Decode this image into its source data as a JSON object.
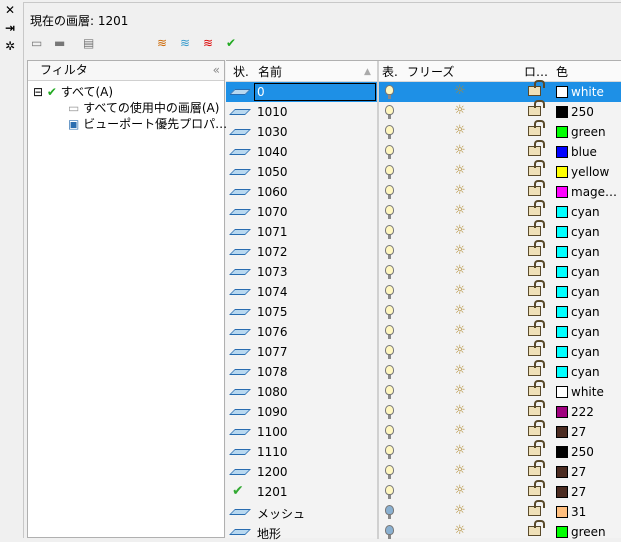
{
  "sidebar_strip": {
    "icons": [
      "close-icon",
      "pin-icon",
      "settings-icon"
    ]
  },
  "title": "現在の画層: 1201",
  "filter": {
    "header": "フィルタ",
    "collapse": "«",
    "tree": [
      {
        "label": "すべて(A)",
        "expanded": true
      },
      {
        "label": "すべての使用中の画層(A)"
      },
      {
        "label": "ビューポート優先プロパ…"
      }
    ]
  },
  "columns": {
    "status": "状.",
    "name": "名前",
    "on": "表.",
    "freeze": "フリーズ",
    "lock": "ロ…",
    "color": "色"
  },
  "layers": [
    {
      "name": "0",
      "color": "white",
      "hex": "#ffffff",
      "on": true,
      "selected": true
    },
    {
      "name": "1010",
      "color": "250",
      "hex": "#000000",
      "on": true
    },
    {
      "name": "1030",
      "color": "green",
      "hex": "#00ff00",
      "on": true
    },
    {
      "name": "1040",
      "color": "blue",
      "hex": "#0000ff",
      "on": true
    },
    {
      "name": "1050",
      "color": "yellow",
      "hex": "#ffff00",
      "on": true
    },
    {
      "name": "1060",
      "color": "mage…",
      "hex": "#ff00ff",
      "on": true
    },
    {
      "name": "1070",
      "color": "cyan",
      "hex": "#00ffff",
      "on": true
    },
    {
      "name": "1071",
      "color": "cyan",
      "hex": "#00ffff",
      "on": true
    },
    {
      "name": "1072",
      "color": "cyan",
      "hex": "#00ffff",
      "on": true
    },
    {
      "name": "1073",
      "color": "cyan",
      "hex": "#00ffff",
      "on": true
    },
    {
      "name": "1074",
      "color": "cyan",
      "hex": "#00ffff",
      "on": true
    },
    {
      "name": "1075",
      "color": "cyan",
      "hex": "#00ffff",
      "on": true
    },
    {
      "name": "1076",
      "color": "cyan",
      "hex": "#00ffff",
      "on": true
    },
    {
      "name": "1077",
      "color": "cyan",
      "hex": "#00ffff",
      "on": true
    },
    {
      "name": "1078",
      "color": "cyan",
      "hex": "#00ffff",
      "on": true
    },
    {
      "name": "1080",
      "color": "white",
      "hex": "#ffffff",
      "on": true
    },
    {
      "name": "1090",
      "color": "222",
      "hex": "#a0007f",
      "on": true
    },
    {
      "name": "1100",
      "color": "27",
      "hex": "#4a2a20",
      "on": true
    },
    {
      "name": "1110",
      "color": "250",
      "hex": "#000000",
      "on": true
    },
    {
      "name": "1200",
      "color": "27",
      "hex": "#4a2a20",
      "on": true
    },
    {
      "name": "1201",
      "color": "27",
      "hex": "#4a2a20",
      "on": true,
      "current": true
    },
    {
      "name": "メッシュ",
      "color": "31",
      "hex": "#ffbf7f",
      "on": false
    },
    {
      "name": "地形",
      "color": "green",
      "hex": "#00ff00",
      "on": false
    }
  ]
}
